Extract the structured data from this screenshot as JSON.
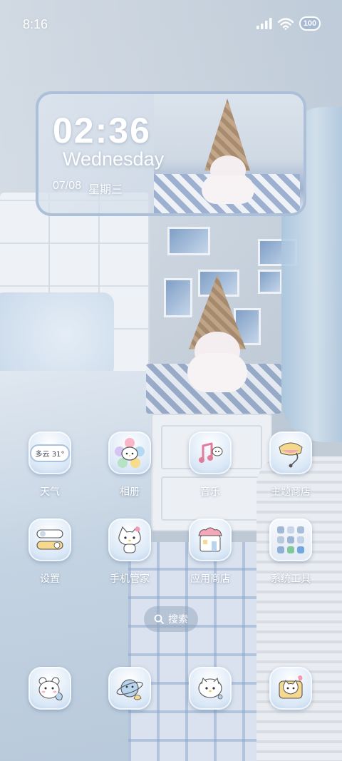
{
  "status_bar": {
    "time": "8:16",
    "battery": "100"
  },
  "clock_widget": {
    "time": "02:36",
    "weekday": "Wednesday",
    "date": "07/08",
    "weekday_cn": "星期三"
  },
  "apps": [
    {
      "label": "天气",
      "icon": "weather-cloud-icon",
      "badge_text": "多云 31°"
    },
    {
      "label": "相册",
      "icon": "gallery-kitty-flower-icon"
    },
    {
      "label": "音乐",
      "icon": "music-note-icon"
    },
    {
      "label": "主题商店",
      "icon": "theme-store-paint-icon"
    },
    {
      "label": "设置",
      "icon": "settings-toggle-icon"
    },
    {
      "label": "手机管家",
      "icon": "phone-manager-kitty-icon"
    },
    {
      "label": "应用商店",
      "icon": "app-store-shop-icon"
    },
    {
      "label": "系统工具",
      "icon": "system-tools-folder-icon"
    }
  ],
  "search": {
    "label": "搜索"
  },
  "dock": [
    {
      "icon": "phone-bear-icon"
    },
    {
      "icon": "messages-planet-icon"
    },
    {
      "icon": "browser-kitty-icon"
    },
    {
      "icon": "camera-kitty-icon"
    }
  ],
  "colors": {
    "icon_bg": "#d9e7f6",
    "text": "#ffffff",
    "widget_border": "#aabed7"
  }
}
